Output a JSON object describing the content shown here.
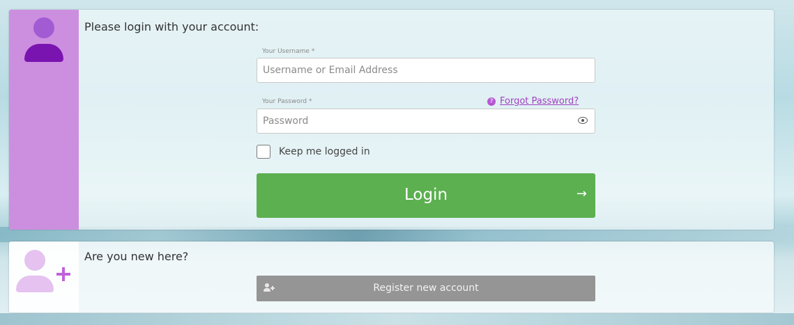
{
  "login": {
    "heading": "Please login with your account:",
    "username_label": "Your Username *",
    "username_placeholder": "Username or Email Address",
    "username_value": "",
    "password_label": "Your Password *",
    "password_placeholder": "Password",
    "password_value": "",
    "forgot_icon": "?",
    "forgot_label": "Forgot Password?",
    "remember_label": "Keep me logged in",
    "remember_checked": false,
    "login_button_label": "Login",
    "arrow_glyph": "→"
  },
  "register": {
    "heading": "Are you new here?",
    "button_label": "Register new account"
  },
  "icons": {
    "login_avatar": "user-icon",
    "register_avatar": "add-user-icon",
    "password_toggle": "eye-icon",
    "forgot_help": "help-icon",
    "login_arrow": "arrow-right-icon"
  },
  "colors": {
    "login_sidebar": "#cc8fe0",
    "avatar_head": "#a25bd3",
    "avatar_body": "#7a14b0",
    "login_button": "#5cb050",
    "register_button": "#959595",
    "link": "#a040c0"
  }
}
